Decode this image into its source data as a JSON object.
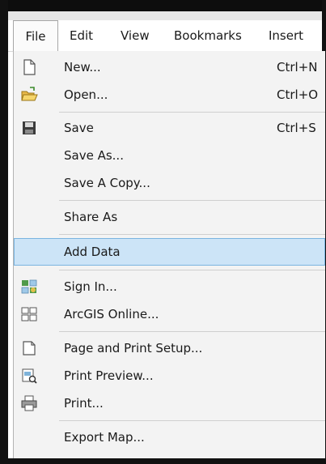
{
  "menubar": {
    "items": [
      {
        "label": "File"
      },
      {
        "label": "Edit"
      },
      {
        "label": "View"
      },
      {
        "label": "Bookmarks"
      },
      {
        "label": "Insert"
      }
    ]
  },
  "file_menu": {
    "items": [
      {
        "label": "New...",
        "shortcut": "Ctrl+N",
        "icon": "new-document-icon"
      },
      {
        "label": "Open...",
        "shortcut": "Ctrl+O",
        "icon": "open-folder-icon"
      },
      {
        "label": "Save",
        "shortcut": "Ctrl+S",
        "icon": "save-disk-icon"
      },
      {
        "label": "Save As..."
      },
      {
        "label": "Save A Copy..."
      },
      {
        "label": "Share As"
      },
      {
        "label": "Add Data",
        "highlighted": true
      },
      {
        "label": "Sign In...",
        "icon": "sign-in-icon"
      },
      {
        "label": "ArcGIS Online...",
        "icon": "arcgis-online-icon"
      },
      {
        "label": "Page and Print Setup...",
        "icon": "page-setup-icon"
      },
      {
        "label": "Print Preview...",
        "icon": "print-preview-icon"
      },
      {
        "label": "Print...",
        "icon": "printer-icon"
      },
      {
        "label": "Export Map..."
      }
    ]
  },
  "colors": {
    "highlight_fill": "#cce4f7",
    "highlight_border": "#7ab4e0",
    "menu_background": "#f3f3f3"
  }
}
